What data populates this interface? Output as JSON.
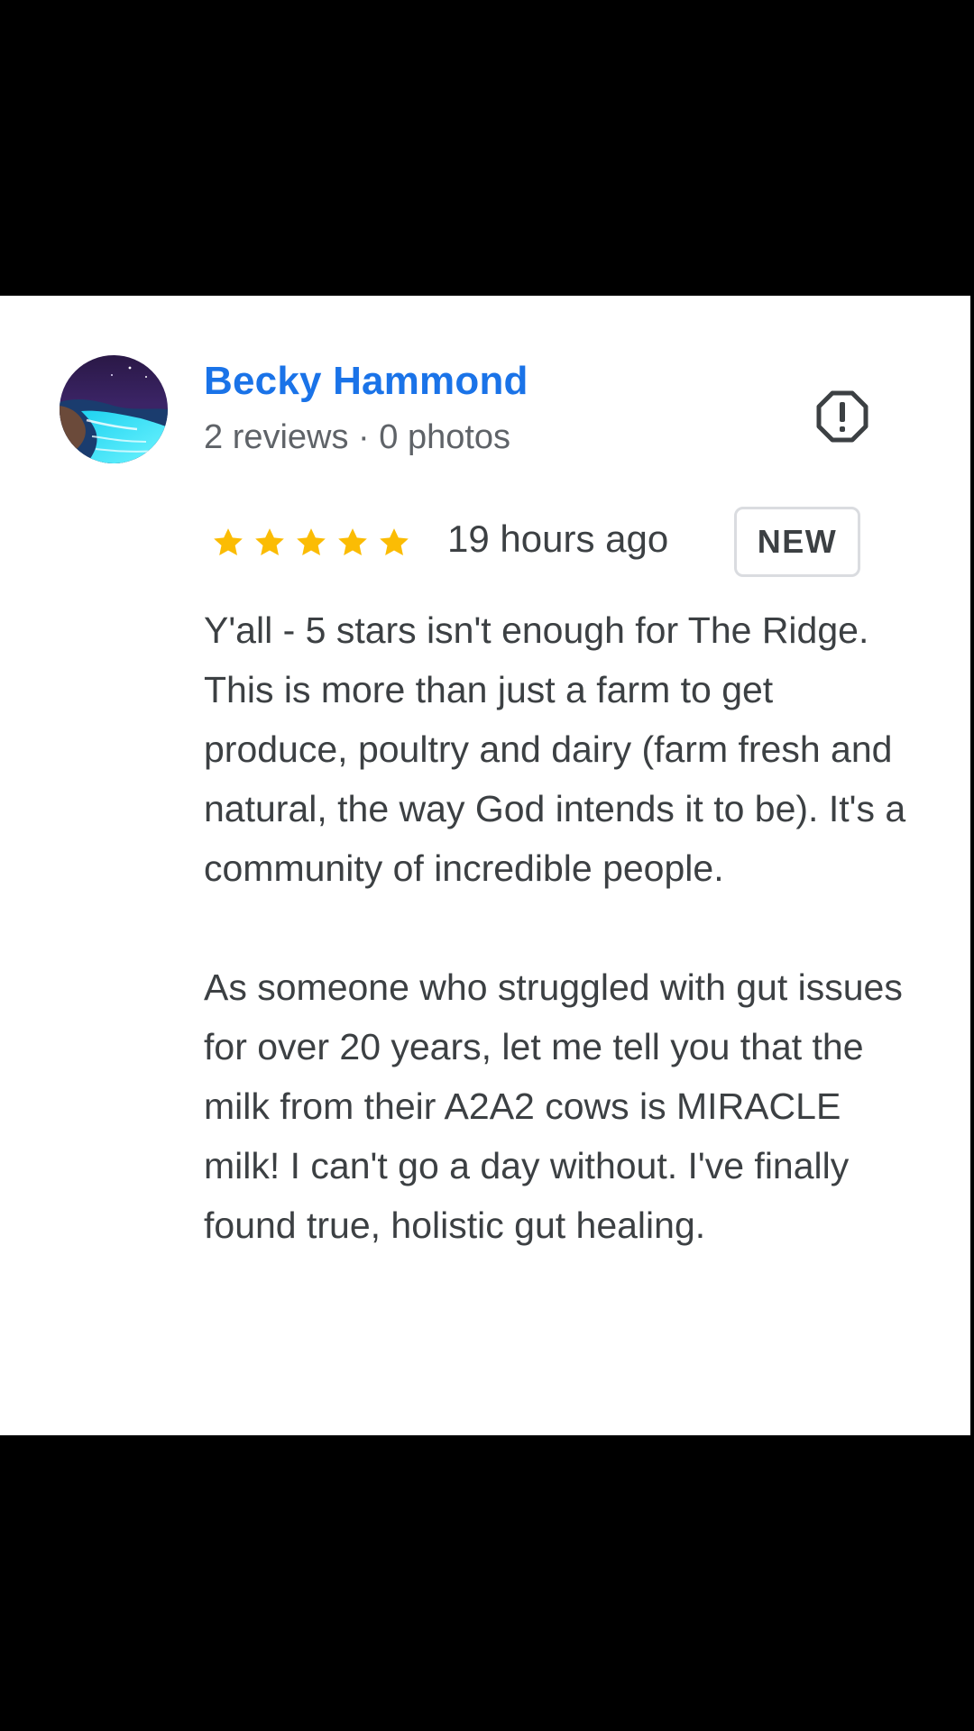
{
  "reviewer": {
    "name": "Becky Hammond",
    "meta": "2 reviews · 0 photos",
    "avatar_icon": "beach-night-avatar"
  },
  "report": {
    "icon": "report-flag-icon"
  },
  "rating": {
    "stars": 5,
    "max_stars": 5,
    "star_color": "#fbbc04",
    "timestamp": "19 hours ago",
    "badge": "NEW"
  },
  "review": {
    "paragraphs": [
      "Y'all - 5 stars isn't enough for The Ridge. This is more than just a farm to get produce, poultry and dairy (farm fresh and natural, the way God intends it to be). It's a community of incredible people.",
      "As someone who struggled with gut issues for over 20 years, let me tell you that the milk from their A2A2 cows is MIRACLE milk! I can't go a day without. I've finally found true, holistic gut healing."
    ]
  },
  "colors": {
    "name": "#1a73e8",
    "text": "#3c4043",
    "meta": "#5f6368",
    "background": "#ffffff",
    "letterbox": "#000000"
  }
}
